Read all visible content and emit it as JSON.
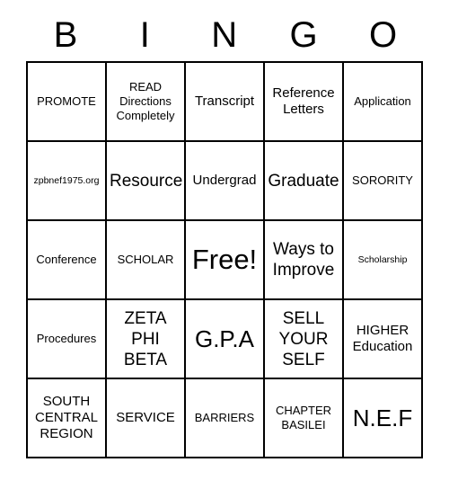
{
  "card": {
    "title_letters": [
      "B",
      "I",
      "N",
      "G",
      "O"
    ],
    "columns": 5,
    "rows": 5,
    "free_space": {
      "row": 2,
      "col": 2,
      "label": "Free!"
    },
    "grid": [
      [
        {
          "text": "PROMOTE",
          "size": "s"
        },
        {
          "text": "READ\nDirections\nCompletely",
          "size": "s"
        },
        {
          "text": "Transcript",
          "size": "m"
        },
        {
          "text": "Reference\nLetters",
          "size": "m"
        },
        {
          "text": "Application",
          "size": "s"
        }
      ],
      [
        {
          "text": "zpbnef1975.org",
          "size": "xs"
        },
        {
          "text": "Resource",
          "size": "l"
        },
        {
          "text": "Undergrad",
          "size": "m"
        },
        {
          "text": "Graduate",
          "size": "l"
        },
        {
          "text": "SORORITY",
          "size": "s"
        }
      ],
      [
        {
          "text": "Conference",
          "size": "s"
        },
        {
          "text": "SCHOLAR",
          "size": "s"
        },
        {
          "text": "Free!",
          "size": "xxl"
        },
        {
          "text": "Ways to\nImprove",
          "size": "l"
        },
        {
          "text": "Scholarship",
          "size": "xs"
        }
      ],
      [
        {
          "text": "Procedures",
          "size": "s"
        },
        {
          "text": "ZETA\nPHI\nBETA",
          "size": "l"
        },
        {
          "text": "G.P.A",
          "size": "xl"
        },
        {
          "text": "SELL\nYOUR\nSELF",
          "size": "l"
        },
        {
          "text": "HIGHER\nEducation",
          "size": "m"
        }
      ],
      [
        {
          "text": "SOUTH\nCENTRAL\nREGION",
          "size": "m"
        },
        {
          "text": "SERVICE",
          "size": "m"
        },
        {
          "text": "BARRIERS",
          "size": "s"
        },
        {
          "text": "CHAPTER\nBASILEI",
          "size": "s"
        },
        {
          "text": "N.E.F",
          "size": "xl"
        }
      ]
    ],
    "colors": {
      "background": "#ffffff",
      "text": "#000000",
      "border": "#000000"
    }
  }
}
